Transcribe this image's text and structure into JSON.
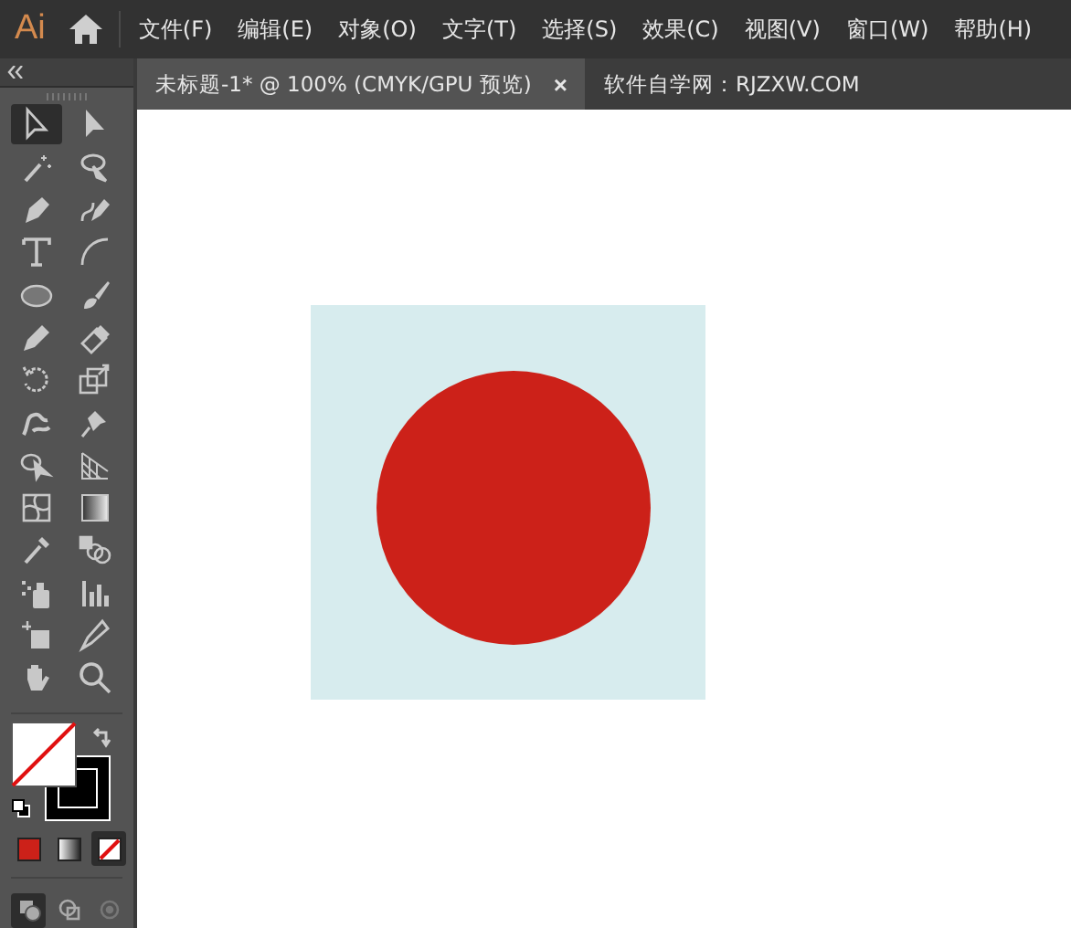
{
  "app": {
    "logo": "Ai"
  },
  "menu": [
    {
      "label": "文件(F)"
    },
    {
      "label": "编辑(E)"
    },
    {
      "label": "对象(O)"
    },
    {
      "label": "文字(T)"
    },
    {
      "label": "选择(S)"
    },
    {
      "label": "效果(C)"
    },
    {
      "label": "视图(V)"
    },
    {
      "label": "窗口(W)"
    },
    {
      "label": "帮助(H)"
    }
  ],
  "tabs": [
    {
      "label": "未标题-1* @ 100% (CMYK/GPU 预览)",
      "close": "×",
      "selected": true
    },
    {
      "label": "软件自学网：RJZXW.COM",
      "selected": false
    }
  ],
  "tools": [
    {
      "kind": "selection",
      "selected": true
    },
    {
      "kind": "direct",
      "selected": false
    },
    {
      "kind": "wand",
      "selected": false
    },
    {
      "kind": "lasso",
      "selected": false
    },
    {
      "kind": "pen",
      "selected": false
    },
    {
      "kind": "curvature",
      "selected": false
    },
    {
      "kind": "type",
      "selected": false
    },
    {
      "kind": "arc",
      "selected": false
    },
    {
      "kind": "ellipse",
      "selected": false
    },
    {
      "kind": "brush",
      "selected": false
    },
    {
      "kind": "blob",
      "selected": false
    },
    {
      "kind": "eraser",
      "selected": false
    },
    {
      "kind": "rotate",
      "selected": false
    },
    {
      "kind": "scale",
      "selected": false
    },
    {
      "kind": "warp",
      "selected": false
    },
    {
      "kind": "pin",
      "selected": false
    },
    {
      "kind": "builder",
      "selected": false
    },
    {
      "kind": "perspective",
      "selected": false
    },
    {
      "kind": "mesh",
      "selected": false
    },
    {
      "kind": "gradient",
      "selected": false
    },
    {
      "kind": "eyedropper",
      "selected": false
    },
    {
      "kind": "blend",
      "selected": false
    },
    {
      "kind": "sprayer",
      "selected": false
    },
    {
      "kind": "graph",
      "selected": false
    },
    {
      "kind": "artboard",
      "selected": false
    },
    {
      "kind": "slice",
      "selected": false
    },
    {
      "kind": "hand",
      "selected": false
    },
    {
      "kind": "zoom",
      "selected": false
    }
  ],
  "color_modes": [
    {
      "kind": "color",
      "selected": false
    },
    {
      "kind": "gradient",
      "selected": false
    },
    {
      "kind": "none",
      "selected": true
    }
  ],
  "draw_modes": [
    {
      "kind": "normal",
      "selected": true
    },
    {
      "kind": "behind",
      "selected": false
    },
    {
      "kind": "inside",
      "selected": false
    }
  ]
}
